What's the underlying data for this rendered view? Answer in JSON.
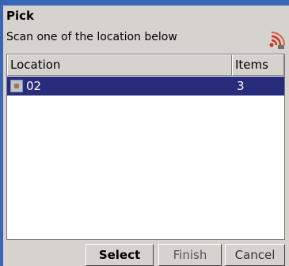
{
  "header": {
    "title": "Pick",
    "subtitle": "Scan one of the location below",
    "status_icon": "wireless-signal-icon"
  },
  "list": {
    "columns": [
      "Location",
      "Items"
    ],
    "rows": [
      {
        "location": "02",
        "items": "3",
        "selected": true
      }
    ]
  },
  "buttons": {
    "select": "Select",
    "finish": "Finish",
    "cancel": "Cancel"
  },
  "colors": {
    "desktop": "#3a66b8",
    "window": "#d6d3ce",
    "selection": "#292c7a"
  }
}
